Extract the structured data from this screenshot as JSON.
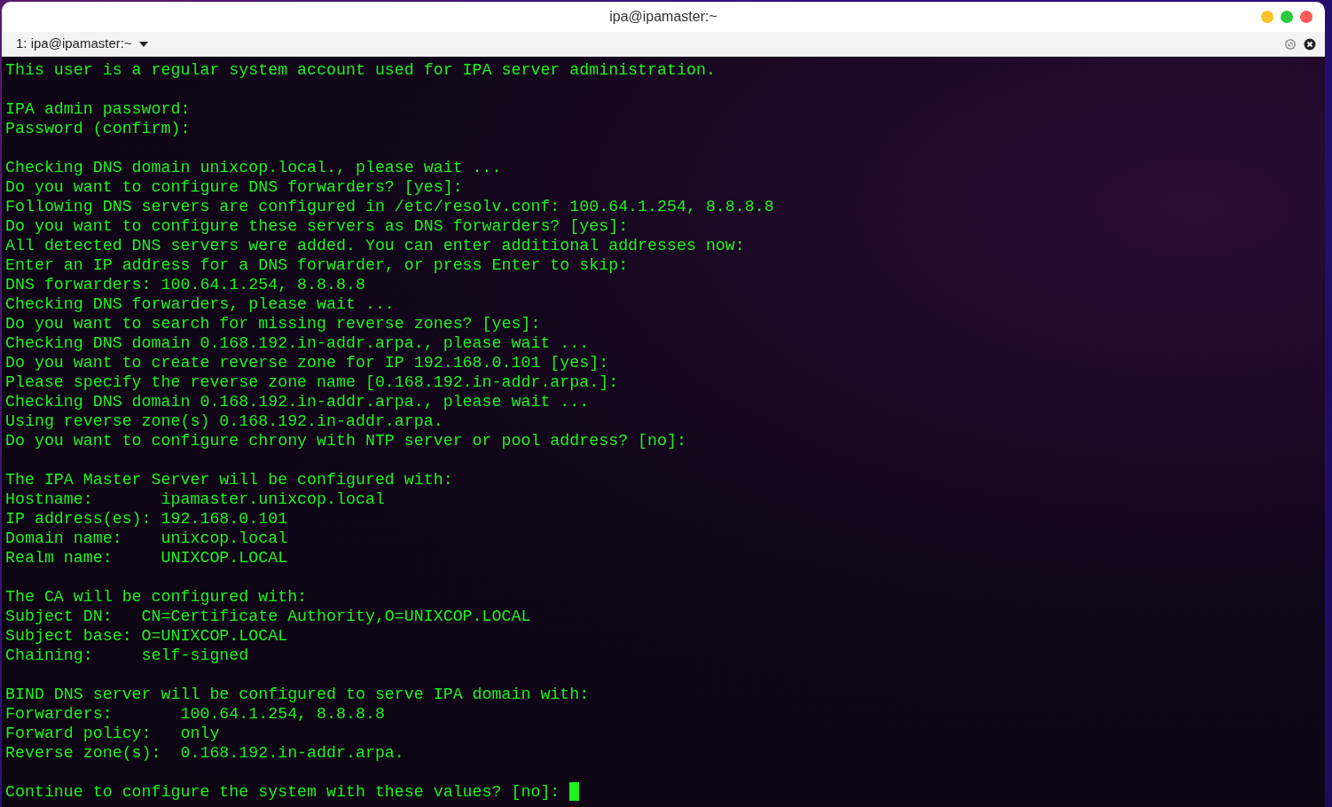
{
  "window": {
    "title": "ipa@ipamaster:~"
  },
  "tabs": [
    {
      "label": "1: ipa@ipamaster:~",
      "selected": true
    }
  ],
  "terminal": {
    "blocks": [
      [
        "This user is a regular system account used for IPA server administration."
      ],
      [
        "IPA admin password:",
        "Password (confirm):"
      ],
      [
        "Checking DNS domain unixcop.local., please wait ...",
        "Do you want to configure DNS forwarders? [yes]:",
        "Following DNS servers are configured in /etc/resolv.conf: 100.64.1.254, 8.8.8.8",
        "Do you want to configure these servers as DNS forwarders? [yes]:",
        "All detected DNS servers were added. You can enter additional addresses now:",
        "Enter an IP address for a DNS forwarder, or press Enter to skip:",
        "DNS forwarders: 100.64.1.254, 8.8.8.8",
        "Checking DNS forwarders, please wait ...",
        "Do you want to search for missing reverse zones? [yes]:",
        "Checking DNS domain 0.168.192.in-addr.arpa., please wait ...",
        "Do you want to create reverse zone for IP 192.168.0.101 [yes]:",
        "Please specify the reverse zone name [0.168.192.in-addr.arpa.]:",
        "Checking DNS domain 0.168.192.in-addr.arpa., please wait ...",
        "Using reverse zone(s) 0.168.192.in-addr.arpa.",
        "Do you want to configure chrony with NTP server or pool address? [no]:"
      ],
      [
        "The IPA Master Server will be configured with:",
        "Hostname:       ipamaster.unixcop.local",
        "IP address(es): 192.168.0.101",
        "Domain name:    unixcop.local",
        "Realm name:     UNIXCOP.LOCAL"
      ],
      [
        "The CA will be configured with:",
        "Subject DN:   CN=Certificate Authority,O=UNIXCOP.LOCAL",
        "Subject base: O=UNIXCOP.LOCAL",
        "Chaining:     self-signed"
      ],
      [
        "BIND DNS server will be configured to serve IPA domain with:",
        "Forwarders:       100.64.1.254, 8.8.8.8",
        "Forward policy:   only",
        "Reverse zone(s):  0.168.192.in-addr.arpa."
      ],
      [
        "Continue to configure the system with these values? [no]: "
      ]
    ]
  }
}
